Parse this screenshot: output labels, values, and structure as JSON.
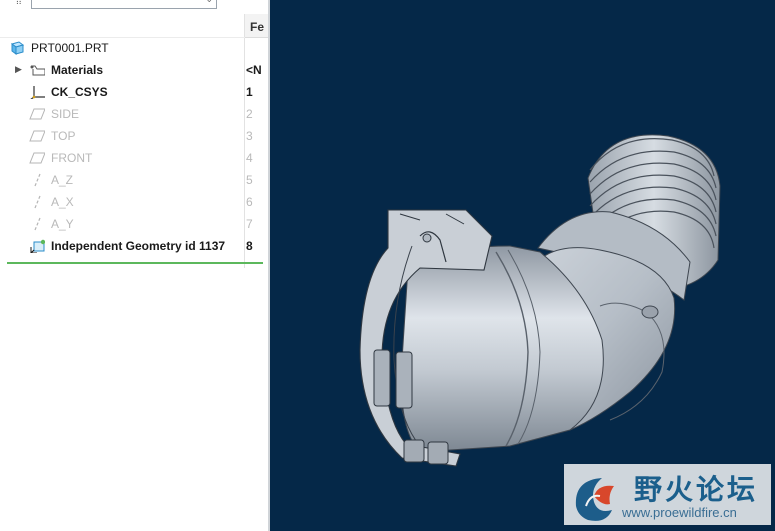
{
  "tree": {
    "column_header": "Fe",
    "items": [
      {
        "label": "PRT0001.PRT",
        "num": "",
        "icon": "part-cube-icon",
        "style": "root",
        "expand": false
      },
      {
        "label": "Materials",
        "num": "<N",
        "icon": "materials-icon",
        "style": "bold",
        "expand": true
      },
      {
        "label": "CK_CSYS",
        "num": "1",
        "icon": "csys-icon",
        "style": "bold",
        "expand": false
      },
      {
        "label": "SIDE",
        "num": "2",
        "icon": "datum-plane-icon",
        "style": "dim",
        "expand": false
      },
      {
        "label": "TOP",
        "num": "3",
        "icon": "datum-plane-icon",
        "style": "dim",
        "expand": false
      },
      {
        "label": "FRONT",
        "num": "4",
        "icon": "datum-plane-icon",
        "style": "dim",
        "expand": false
      },
      {
        "label": "A_Z",
        "num": "5",
        "icon": "datum-axis-icon",
        "style": "dim",
        "expand": false
      },
      {
        "label": "A_X",
        "num": "6",
        "icon": "datum-axis-icon",
        "style": "dim",
        "expand": false
      },
      {
        "label": "A_Y",
        "num": "7",
        "icon": "datum-axis-icon",
        "style": "dim",
        "expand": false
      },
      {
        "label": "Independent Geometry id 1137",
        "num": "8",
        "icon": "independent-geometry-icon",
        "style": "bold",
        "expand": false
      }
    ]
  },
  "watermark": {
    "title": "野火论坛",
    "url": "www.proewildfire.cn"
  },
  "colors": {
    "viewport_bg": "#052848",
    "insert_line": "#5cb85c",
    "model": "#b8bfc7"
  }
}
